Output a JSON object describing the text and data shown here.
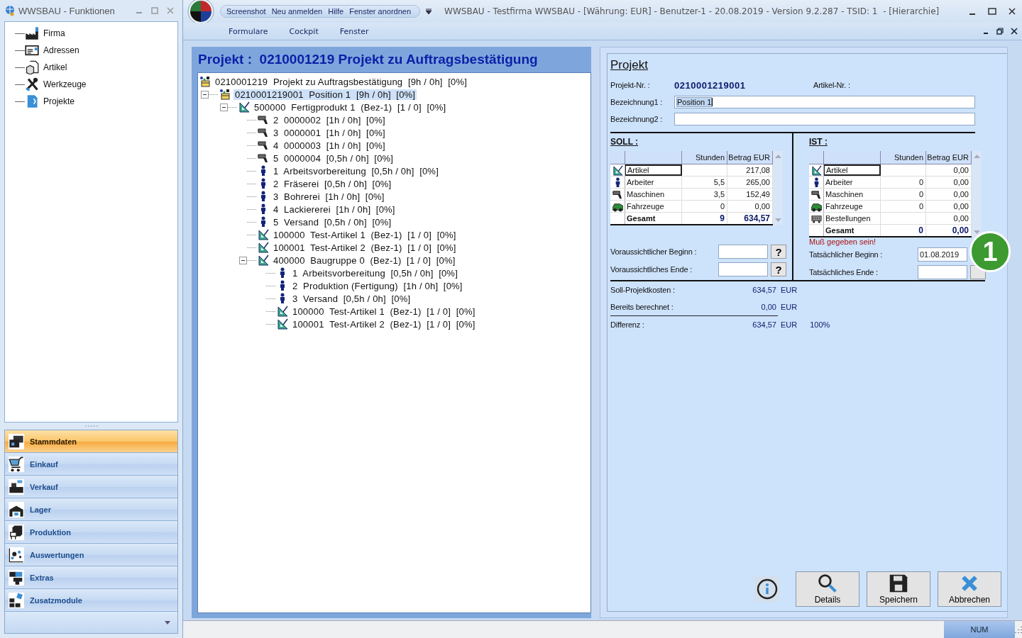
{
  "functions_window": {
    "title": "WWSBAU - Funktionen",
    "items": [
      {
        "label": "Firma",
        "kind": "firm"
      },
      {
        "label": "Adressen",
        "kind": "address"
      },
      {
        "label": "Artikel",
        "kind": "item"
      },
      {
        "label": "Werkzeuge",
        "kind": "tools"
      },
      {
        "label": "Projekte",
        "kind": "projects"
      }
    ],
    "nav": [
      {
        "label": "Stammdaten",
        "kind": "masterdata",
        "selected": true
      },
      {
        "label": "Einkauf",
        "kind": "cart",
        "selected": false
      },
      {
        "label": "Verkauf",
        "kind": "register",
        "selected": false
      },
      {
        "label": "Lager",
        "kind": "warehouse",
        "selected": false
      },
      {
        "label": "Produktion",
        "kind": "production",
        "selected": false
      },
      {
        "label": "Auswertungen",
        "kind": "analytics",
        "selected": false
      },
      {
        "label": "Extras",
        "kind": "extras",
        "selected": false
      },
      {
        "label": "Zusatzmodule",
        "kind": "modules",
        "selected": false
      }
    ]
  },
  "main_window": {
    "quick_access": [
      "Screenshot",
      "Neu anmelden",
      "Hilfe",
      "Fenster anordnen"
    ],
    "title": "WWSBAU - Testfirma WWSBAU - [Währung: EUR] - Benutzer-1 - 20.08.2019 - Version 9.2.287 - TSID: 1  - [Hierarchie]",
    "menu": [
      "Formulare",
      "Cockpit",
      "Fenster"
    ]
  },
  "project_panel": {
    "heading": "Projekt :  0210001219 Projekt zu Auftragsbestätigung",
    "tree": [
      {
        "label": "0210001219  Projekt zu Auftragsbestätigung  [9h / 0h]  [0%]",
        "kind": "project",
        "selected": false,
        "children": [
          {
            "label": "0210001219001  Position 1  [9h / 0h]  [0%]",
            "kind": "project",
            "selected": true,
            "expanded": true,
            "children": [
              {
                "label": "500000  Fertigprodukt 1  (Bez-1)  [1 / 0]  [0%]",
                "kind": "article",
                "selected": false,
                "expanded": true,
                "children": [
                  {
                    "label": "2  0000002  [1h / 0h]  [0%]",
                    "kind": "machine",
                    "selected": false
                  },
                  {
                    "label": "3  0000001  [1h / 0h]  [0%]",
                    "kind": "machine",
                    "selected": false
                  },
                  {
                    "label": "4  0000003  [1h / 0h]  [0%]",
                    "kind": "machine",
                    "selected": false
                  },
                  {
                    "label": "5  0000004  [0,5h / 0h]  [0%]",
                    "kind": "machine",
                    "selected": false
                  },
                  {
                    "label": "1  Arbeitsvorbereitung  [0,5h / 0h]  [0%]",
                    "kind": "worker",
                    "selected": false
                  },
                  {
                    "label": "2  Fräserei  [0,5h / 0h]  [0%]",
                    "kind": "worker",
                    "selected": false
                  },
                  {
                    "label": "3  Bohrerei  [1h / 0h]  [0%]",
                    "kind": "worker",
                    "selected": false
                  },
                  {
                    "label": "4  Lackiererei  [1h / 0h]  [0%]",
                    "kind": "worker",
                    "selected": false
                  },
                  {
                    "label": "5  Versand  [0,5h / 0h]  [0%]",
                    "kind": "worker",
                    "selected": false
                  },
                  {
                    "label": "100000  Test-Artikel 1  (Bez-1)  [1 / 0]  [0%]",
                    "kind": "article",
                    "selected": false
                  },
                  {
                    "label": "100001  Test-Artikel 2  (Bez-1)  [1 / 0]  [0%]",
                    "kind": "article",
                    "selected": false
                  },
                  {
                    "label": "400000  Baugruppe 0  (Bez-1)  [1 / 0]  [0%]",
                    "kind": "article",
                    "selected": false,
                    "expanded": true,
                    "children": [
                      {
                        "label": "1  Arbeitsvorbereitung  [0,5h / 0h]  [0%]",
                        "kind": "worker",
                        "selected": false
                      },
                      {
                        "label": "2  Produktion (Fertigung)  [1h / 0h]  [0%]",
                        "kind": "worker",
                        "selected": false
                      },
                      {
                        "label": "3  Versand  [0,5h / 0h]  [0%]",
                        "kind": "worker",
                        "selected": false
                      },
                      {
                        "label": "100000  Test-Artikel 1  (Bez-1)  [1 / 0]  [0%]",
                        "kind": "article",
                        "selected": false
                      },
                      {
                        "label": "100001  Test-Artikel 2  (Bez-1)  [1 / 0]  [0%]",
                        "kind": "article",
                        "selected": false
                      }
                    ]
                  }
                ]
              }
            ]
          }
        ]
      }
    ]
  },
  "detail": {
    "title": "Projekt",
    "project_no": {
      "label": "Projekt-Nr. :",
      "value": "0210001219001"
    },
    "article_no": {
      "label": "Artikel-Nr. :"
    },
    "name_fields": [
      {
        "label": "Bezeichnung1 :",
        "value": "Position 1",
        "selected": true
      },
      {
        "label": "Bezeichnung2 :",
        "selected": false
      }
    ],
    "soll": {
      "heading": "SOLL :",
      "columns": [
        "Stunden",
        "Betrag EUR"
      ],
      "rows": [
        {
          "kind": "article",
          "label": "Artikel",
          "amount": "217,08",
          "selected": true
        },
        {
          "kind": "worker",
          "label": "Arbeiter",
          "hours": "5,5",
          "amount": "265,00",
          "selected": false
        },
        {
          "kind": "machine",
          "label": "Maschinen",
          "hours": "3,5",
          "amount": "152,49",
          "selected": false
        },
        {
          "kind": "vehicle",
          "label": "Fahrzeuge",
          "hours": "0",
          "amount": "0,00",
          "selected": false
        },
        {
          "kind": "total",
          "label": "Gesamt",
          "hours": "9",
          "amount": "634,57",
          "selected": false
        }
      ],
      "dates": [
        {
          "label": "Voraussichtlicher Beginn :",
          "button": "?"
        },
        {
          "label": "Voraussichtliches Ende :",
          "button": "?"
        }
      ]
    },
    "ist": {
      "heading": "IST :",
      "columns": [
        "Stunden",
        "Betrag EUR"
      ],
      "rows": [
        {
          "kind": "article",
          "label": "Artikel",
          "amount": "0,00",
          "selected": true
        },
        {
          "kind": "worker",
          "label": "Arbeiter",
          "hours": "0",
          "amount": "0,00",
          "selected": false
        },
        {
          "kind": "machine",
          "label": "Maschinen",
          "hours": "0",
          "amount": "0,00",
          "selected": false
        },
        {
          "kind": "vehicle",
          "label": "Fahrzeuge",
          "hours": "0",
          "amount": "0,00",
          "selected": false
        },
        {
          "kind": "order",
          "label": "Bestellungen",
          "amount": "0,00",
          "selected": false
        },
        {
          "kind": "total",
          "label": "Gesamt",
          "hours": "0",
          "amount": "0,00",
          "selected": false
        }
      ],
      "warning": "Muß gegeben sein!",
      "dates": [
        {
          "label": "Tatsächlicher Beginn :",
          "value": "01.08.2019"
        },
        {
          "label": "Tatsächliches Ende :",
          "has_button": true
        }
      ]
    },
    "summary": [
      {
        "label": "Soll-Projektkosten :",
        "amount": "634,57",
        "currency": "EUR",
        "rule_above": false
      },
      {
        "label": "Bereits berechnet :",
        "amount": "0,00",
        "currency": "EUR",
        "rule_above": false
      },
      {
        "label": "Differenz :",
        "amount": "634,57",
        "currency": "EUR",
        "percent": "100%",
        "rule_above": true
      }
    ],
    "buttons": [
      {
        "label": "Details",
        "kind": "search"
      },
      {
        "label": "Speichern",
        "kind": "save"
      },
      {
        "label": "Abbrechen",
        "kind": "cancel"
      }
    ]
  },
  "callout_badge": "1",
  "status_bar": {
    "num": "NUM"
  }
}
